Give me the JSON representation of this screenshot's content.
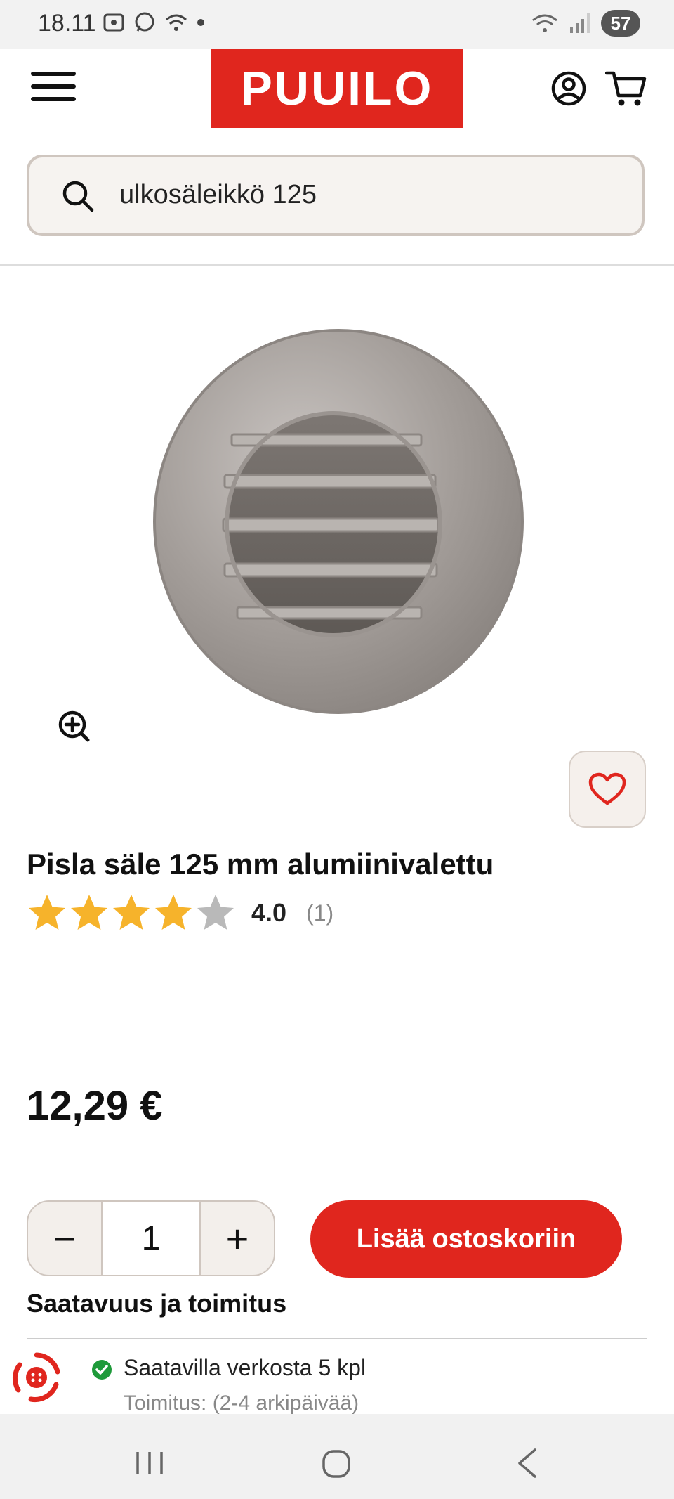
{
  "status_bar": {
    "time": "18.11",
    "battery": "57"
  },
  "header": {
    "logo_text": "PUUILO",
    "brand_color": "#e0261e"
  },
  "search": {
    "value": "ulkosäleikkö 125",
    "icon": "search-icon"
  },
  "product": {
    "title": "Pisla säle 125 mm alumiinivalettu",
    "rating_value": "4.0",
    "rating_count": "(1)",
    "rating_stars": 4,
    "rating_max": 5,
    "price": "12,29 €"
  },
  "cart": {
    "quantity": "1",
    "minus_label": "−",
    "plus_label": "+",
    "add_to_cart_label": "Lisää ostoskoriin"
  },
  "availability": {
    "title": "Saatavuus ja toimitus",
    "stock_text": "Saatavilla verkosta 5 kpl",
    "delivery_text": "Toimitus: (2-4 arkipäivää)",
    "status_color": "#1e9a3a"
  }
}
